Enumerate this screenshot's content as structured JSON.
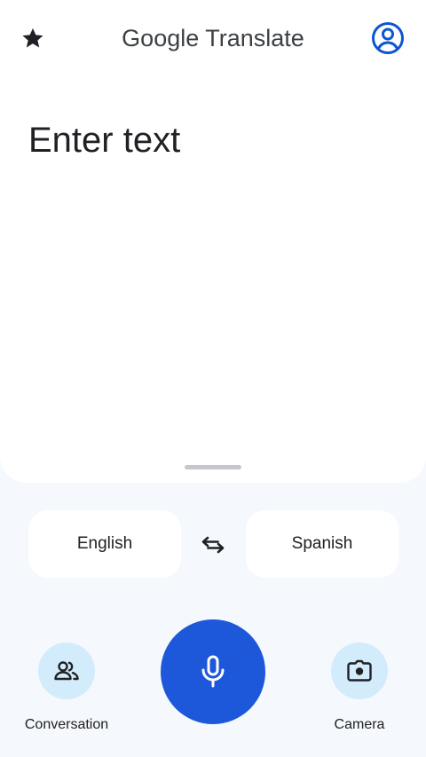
{
  "header": {
    "brand": "Google",
    "product": "Translate",
    "star_icon": "star-icon",
    "account_icon": "account-circle-icon"
  },
  "input": {
    "placeholder": "Enter text",
    "value": ""
  },
  "languages": {
    "source": "English",
    "target": "Spanish",
    "swap_icon": "swap-arrows-icon"
  },
  "actions": {
    "conversation": {
      "label": "Conversation",
      "icon": "people-icon"
    },
    "voice": {
      "icon": "microphone-icon"
    },
    "camera": {
      "label": "Camera",
      "icon": "camera-icon"
    }
  },
  "colors": {
    "accent": "#1c58d9",
    "action_bubble": "#d3ecfb",
    "account_icon": "#0b57d0",
    "background": "#f5f8fc"
  }
}
